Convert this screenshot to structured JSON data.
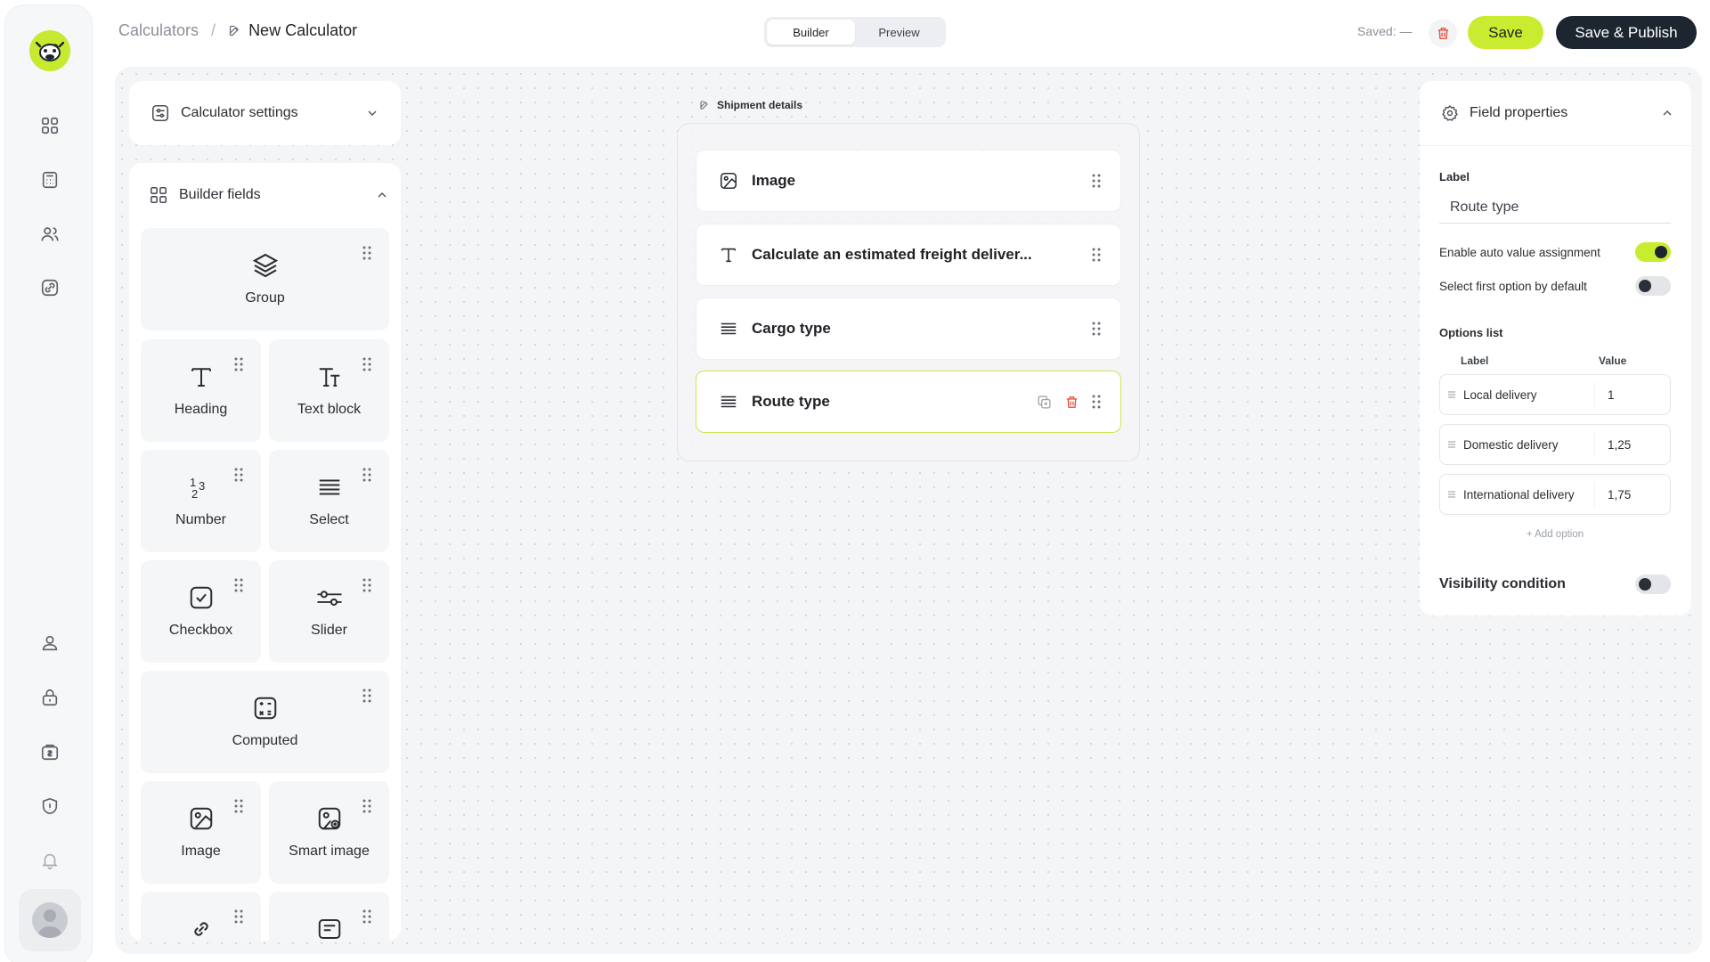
{
  "breadcrumb": {
    "root": "Calculators",
    "separator": "/",
    "current": "New Calculator"
  },
  "mode_tabs": [
    {
      "label": "Builder",
      "active": true
    },
    {
      "label": "Preview",
      "active": false
    }
  ],
  "header": {
    "saved_status": "Saved: —",
    "save_label": "Save",
    "publish_label": "Save & Publish"
  },
  "left_nav": {
    "top_icons": [
      "dashboard-icon",
      "calculator-icon",
      "users-icon",
      "link-icon"
    ],
    "bottom_icons": [
      "user-icon",
      "lock-icon",
      "billing-icon",
      "shield-icon",
      "bell-icon"
    ]
  },
  "settings_panel": {
    "title": "Calculator settings"
  },
  "builder_fields": {
    "title": "Builder fields",
    "tiles": [
      {
        "label": "Group",
        "icon": "layers-icon"
      },
      {
        "label": "Heading",
        "icon": "heading-icon"
      },
      {
        "label": "Text block",
        "icon": "text-block-icon"
      },
      {
        "label": "Number",
        "icon": "number-icon"
      },
      {
        "label": "Select",
        "icon": "select-icon"
      },
      {
        "label": "Checkbox",
        "icon": "checkbox-icon"
      },
      {
        "label": "Slider",
        "icon": "slider-icon"
      },
      {
        "label": "Computed",
        "icon": "computed-icon"
      },
      {
        "label": "Image",
        "icon": "image-icon"
      },
      {
        "label": "Smart image",
        "icon": "smart-image-icon"
      }
    ]
  },
  "canvas": {
    "group_title": "Shipment details",
    "fields": [
      {
        "label": "Image",
        "icon": "image-icon",
        "selected": false
      },
      {
        "label": "Calculate an estimated freight deliver...",
        "icon": "heading-icon",
        "selected": false
      },
      {
        "label": "Cargo type",
        "icon": "select-icon",
        "selected": false
      },
      {
        "label": "Route type",
        "icon": "select-icon",
        "selected": true
      }
    ]
  },
  "properties": {
    "title": "Field properties",
    "label_caption": "Label",
    "label_value": "Route type",
    "auto_value": {
      "label": "Enable auto value assignment",
      "on": true
    },
    "first_option": {
      "label": "Select first option by default",
      "on": false
    },
    "options_title": "Options list",
    "options_header": {
      "label": "Label",
      "value": "Value"
    },
    "options": [
      {
        "label": "Local delivery",
        "value": "1"
      },
      {
        "label": "Domestic delivery",
        "value": "1,25"
      },
      {
        "label": "International delivery",
        "value": "1,75"
      }
    ],
    "add_option": "+ Add option",
    "visibility": {
      "label": "Visibility condition",
      "on": false
    }
  },
  "colors": {
    "accent": "#c8ec2f",
    "dark": "#1c2530",
    "danger": "#e0533f",
    "canvas_bg": "#f4f5f7"
  }
}
